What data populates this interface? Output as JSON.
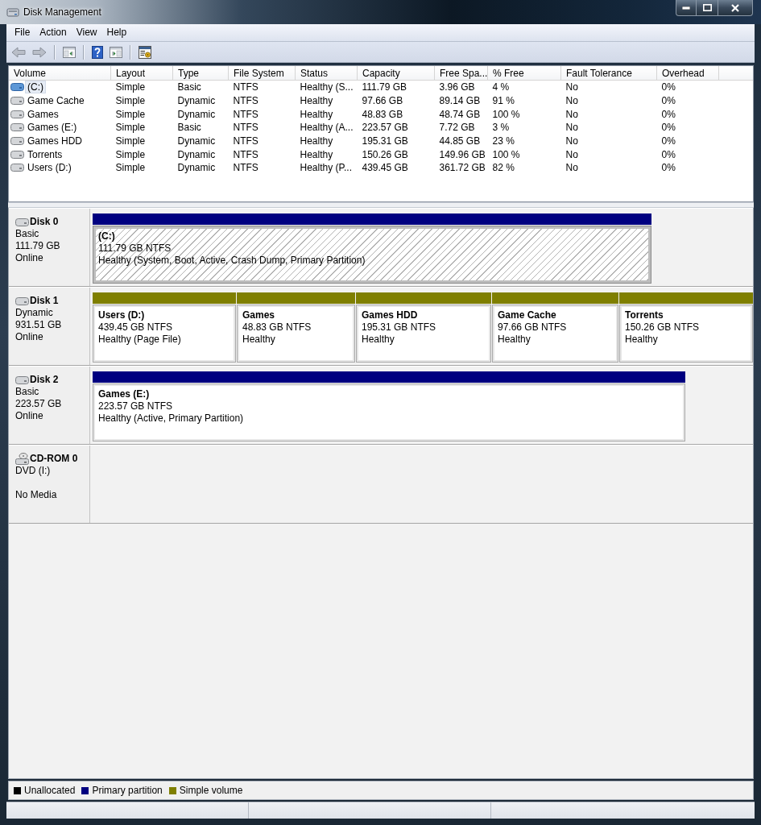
{
  "window": {
    "title": "Disk Management"
  },
  "menu_bar": [
    {
      "label": "File"
    },
    {
      "label": "Action"
    },
    {
      "label": "View"
    },
    {
      "label": "Help"
    }
  ],
  "volume_table": {
    "columns": [
      "Volume",
      "Layout",
      "Type",
      "File System",
      "Status",
      "Capacity",
      "Free Spa...",
      "% Free",
      "Fault Tolerance",
      "Overhead"
    ],
    "rows": [
      {
        "selected": true,
        "cells": [
          "(C:)",
          "Simple",
          "Basic",
          "NTFS",
          "Healthy (S...",
          "111.79 GB",
          "3.96 GB",
          "4 %",
          "No",
          "0%"
        ]
      },
      {
        "selected": false,
        "cells": [
          "Game Cache",
          "Simple",
          "Dynamic",
          "NTFS",
          "Healthy",
          "97.66 GB",
          "89.14 GB",
          "91 %",
          "No",
          "0%"
        ]
      },
      {
        "selected": false,
        "cells": [
          "Games",
          "Simple",
          "Dynamic",
          "NTFS",
          "Healthy",
          "48.83 GB",
          "48.74 GB",
          "100 %",
          "No",
          "0%"
        ]
      },
      {
        "selected": false,
        "cells": [
          "Games (E:)",
          "Simple",
          "Basic",
          "NTFS",
          "Healthy (A...",
          "223.57 GB",
          "7.72 GB",
          "3 %",
          "No",
          "0%"
        ]
      },
      {
        "selected": false,
        "cells": [
          "Games HDD",
          "Simple",
          "Dynamic",
          "NTFS",
          "Healthy",
          "195.31 GB",
          "44.85 GB",
          "23 %",
          "No",
          "0%"
        ]
      },
      {
        "selected": false,
        "cells": [
          "Torrents",
          "Simple",
          "Dynamic",
          "NTFS",
          "Healthy",
          "150.26 GB",
          "149.96 GB",
          "100 %",
          "No",
          "0%"
        ]
      },
      {
        "selected": false,
        "cells": [
          "Users (D:)",
          "Simple",
          "Dynamic",
          "NTFS",
          "Healthy (P...",
          "439.45 GB",
          "361.72 GB",
          "82 %",
          "No",
          "0%"
        ]
      }
    ]
  },
  "disks": [
    {
      "kind": "disk",
      "name": "Disk 0",
      "type": "Basic",
      "size": "111.79 GB",
      "status": "Online",
      "partitions": [
        {
          "name": "(C:)",
          "size": "111.79 GB NTFS",
          "status": "Healthy (System, Boot, Active, Crash Dump, Primary Partition)",
          "color": "#000080",
          "selected": true
        }
      ]
    },
    {
      "kind": "disk",
      "name": "Disk 1",
      "type": "Dynamic",
      "size": "931.51 GB",
      "status": "Online",
      "partitions": [
        {
          "name": "Users (D:)",
          "size": "439.45 GB NTFS",
          "status": "Healthy (Page File)",
          "color": "#7f7f00",
          "selected": false
        },
        {
          "name": "Games",
          "size": "48.83 GB NTFS",
          "status": "Healthy",
          "color": "#7f7f00",
          "selected": false
        },
        {
          "name": "Games HDD",
          "size": "195.31 GB NTFS",
          "status": "Healthy",
          "color": "#7f7f00",
          "selected": false
        },
        {
          "name": "Game Cache",
          "size": "97.66 GB NTFS",
          "status": "Healthy",
          "color": "#7f7f00",
          "selected": false
        },
        {
          "name": "Torrents",
          "size": "150.26 GB NTFS",
          "status": "Healthy",
          "color": "#7f7f00",
          "selected": false
        }
      ]
    },
    {
      "kind": "disk",
      "name": "Disk 2",
      "type": "Basic",
      "size": "223.57 GB",
      "status": "Online",
      "partitions": [
        {
          "name": "Games (E:)",
          "size": "223.57 GB NTFS",
          "status": "Healthy (Active, Primary Partition)",
          "color": "#000080",
          "selected": false
        }
      ]
    },
    {
      "kind": "cdrom",
      "name": "CD-ROM 0",
      "type": "DVD (I:)",
      "status": "No Media"
    }
  ],
  "legend": [
    {
      "label": "Unallocated",
      "color": "#000000"
    },
    {
      "label": "Primary partition",
      "color": "#000080"
    },
    {
      "label": "Simple volume",
      "color": "#7f7f00"
    }
  ]
}
